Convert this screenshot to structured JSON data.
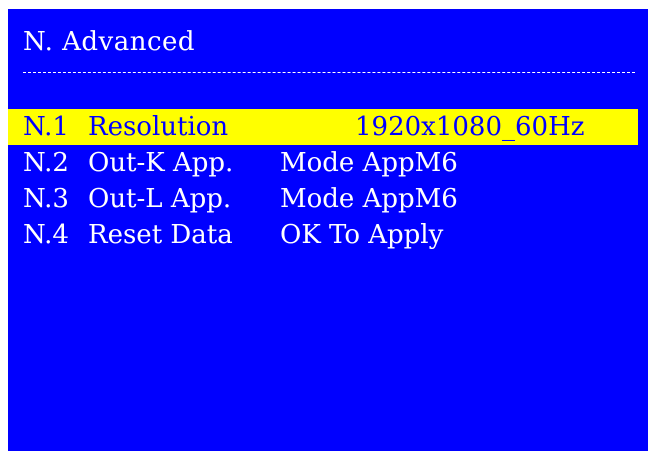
{
  "title": "N. Advanced",
  "colors": {
    "background": "#0000ff",
    "text": "#ffffff",
    "highlight": "#ffff00",
    "highlight_text": "#0000ff"
  },
  "items": [
    {
      "code": "N.1",
      "label": "Resolution",
      "value": "1920x1080_60Hz",
      "selected": true
    },
    {
      "code": "N.2",
      "label": "Out-K App.",
      "value": "Mode AppM6",
      "selected": false
    },
    {
      "code": "N.3",
      "label": "Out-L App.",
      "value": "Mode AppM6",
      "selected": false
    },
    {
      "code": "N.4",
      "label": "Reset Data",
      "value": "OK To Apply",
      "selected": false
    }
  ]
}
